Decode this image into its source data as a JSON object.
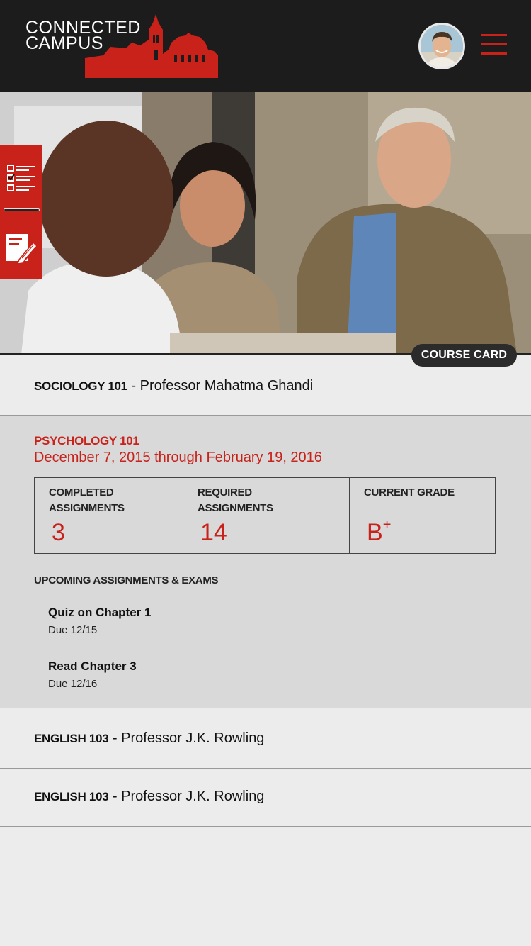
{
  "header": {
    "logo_line1": "CONNECTED",
    "logo_line2": "CAMPUS",
    "menu_icon": "hamburger-icon",
    "avatar": "user-avatar"
  },
  "sidebar_tools": [
    {
      "icon": "checklist-icon"
    },
    {
      "icon": "notepad-edit-icon"
    }
  ],
  "hero": {
    "badge": "COURSE CARD"
  },
  "courses": [
    {
      "code": "SOCIOLOGY 101",
      "professor": "- Professor Mahatma Ghandi"
    },
    {
      "code": "ENGLISH 103",
      "professor": "- Professor J.K. Rowling"
    },
    {
      "code": "ENGLISH 103",
      "professor": "- Professor J.K. Rowling"
    }
  ],
  "expanded_course": {
    "code": "PSYCHOLOGY 101",
    "dates": "December 7, 2015 through February 19, 2016",
    "stats": [
      {
        "label": "COMPLETED ASSIGNMENTS",
        "value": "3"
      },
      {
        "label": "REQUIRED ASSIGNMENTS",
        "value": "14"
      },
      {
        "label": "CURRENT GRADE",
        "value": "B",
        "sup": "+"
      }
    ],
    "upcoming_title": "UPCOMING ASSIGNMENTS & EXAMS",
    "assignments": [
      {
        "title": "Quiz on Chapter 1",
        "due": "Due 12/15"
      },
      {
        "title": "Read Chapter 3",
        "due": "Due 12/16"
      }
    ]
  },
  "colors": {
    "accent": "#c8221a",
    "topbar": "#1c1c1c",
    "background": "#ececec",
    "expanded_bg": "#d9d9d9"
  }
}
